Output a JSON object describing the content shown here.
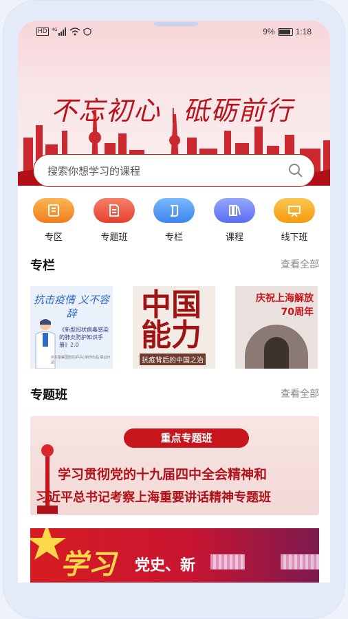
{
  "status": {
    "left_icons": [
      "hd-icon",
      "4g-signal-icon",
      "wifi-icon",
      "shield-icon"
    ],
    "battery": "9%",
    "time": "1:18"
  },
  "banner": {
    "headline_main": "不忘初心",
    "headline_second": "砥砺前行"
  },
  "search": {
    "placeholder": "搜索你想学习的课程"
  },
  "categories": [
    {
      "label": "专区",
      "icon": "zone-icon",
      "color": "#f39a2a"
    },
    {
      "label": "专题班",
      "icon": "document-icon",
      "color": "#f05a4a"
    },
    {
      "label": "专栏",
      "icon": "scroll-icon",
      "color": "#4e9cf6"
    },
    {
      "label": "课程",
      "icon": "books-icon",
      "color": "#6d86f3"
    },
    {
      "label": "线下班",
      "icon": "presentation-icon",
      "color": "#f7a81e"
    }
  ],
  "columns": {
    "title": "专栏",
    "more": "查看全部",
    "items": [
      {
        "title": "抗击疫情 义不容辞",
        "caption": "《新型冠状病毒感染的肺炎防护知识手册》2.0",
        "footer": "启东警察国防防护中心制作出品 联合出品"
      },
      {
        "title": "中国能力",
        "caption": "抗疫背后的中国之治"
      },
      {
        "title": "庆祝上海解放 70周年"
      }
    ]
  },
  "topics": {
    "title": "专题班",
    "more": "查看全部",
    "promo": {
      "pill": "重点专题班",
      "line1": "学习贯彻党的十九届四中全会精神和",
      "line2": "习近平总书记考察上海重要讲话精神专题班"
    }
  },
  "promo2": {
    "title": "学习",
    "subtitle": "党史、新"
  },
  "colors": {
    "accent": "#c8141b",
    "banner_bg": "#f7d5d8"
  }
}
